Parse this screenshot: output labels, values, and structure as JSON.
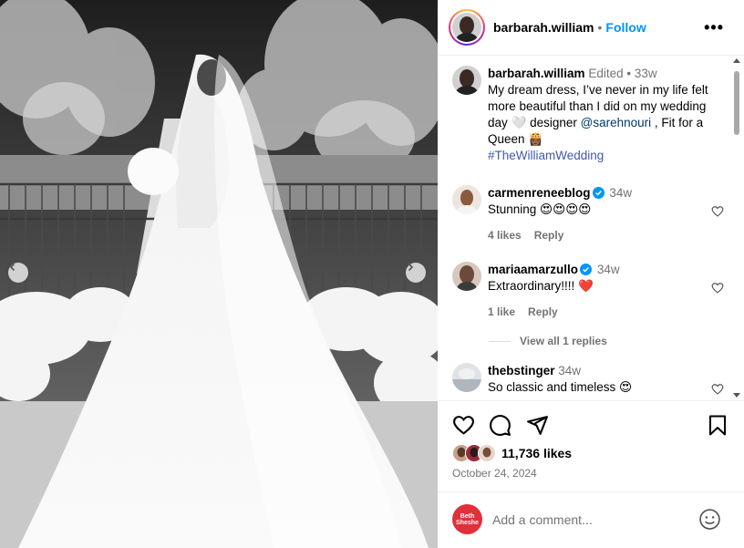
{
  "post": {
    "author": "barbarah.william",
    "follow_label": "Follow",
    "more_label": "•••",
    "caption": {
      "username": "barbarah.william",
      "edited": "Edited",
      "dot": "•",
      "time": "33w",
      "text_part1": "My dream dress, I’ve never in my life felt more beautiful than I did on my wedding day 🤍 designer ",
      "mention": "@sarehnouri",
      "text_part2": " , Fit for a Queen 👸🏾",
      "hashtag": "#TheWilliamWedding"
    },
    "comments": [
      {
        "username": "carmenreneeblog",
        "verified": true,
        "time": "34w",
        "text": "Stunning 😍😍😍😍",
        "likes": "4 likes",
        "reply": "Reply"
      },
      {
        "username": "mariaamarzullo",
        "verified": true,
        "time": "34w",
        "text": "Extraordinary!!!! ❤️",
        "likes": "1 like",
        "reply": "Reply",
        "view_replies": "View all 1 replies"
      },
      {
        "username": "thebstinger",
        "verified": false,
        "time": "34w",
        "text": "So classic and timeless 😍"
      }
    ],
    "likes_count": "11,736 likes",
    "date": "October 24, 2024",
    "add_comment_placeholder": "Add a comment...",
    "my_avatar_text": "Beth Sheshe"
  },
  "colors": {
    "accent": "#0095f6",
    "verified": "#0095f6",
    "muted": "#737373",
    "mention": "#00376b",
    "hashtag": "#4059ad"
  },
  "icons": [
    "more-icon",
    "verified-icon",
    "heart-icon",
    "comment-icon",
    "share-icon",
    "bookmark-icon",
    "emoji-icon",
    "chevron-left-icon",
    "chevron-right-icon"
  ]
}
